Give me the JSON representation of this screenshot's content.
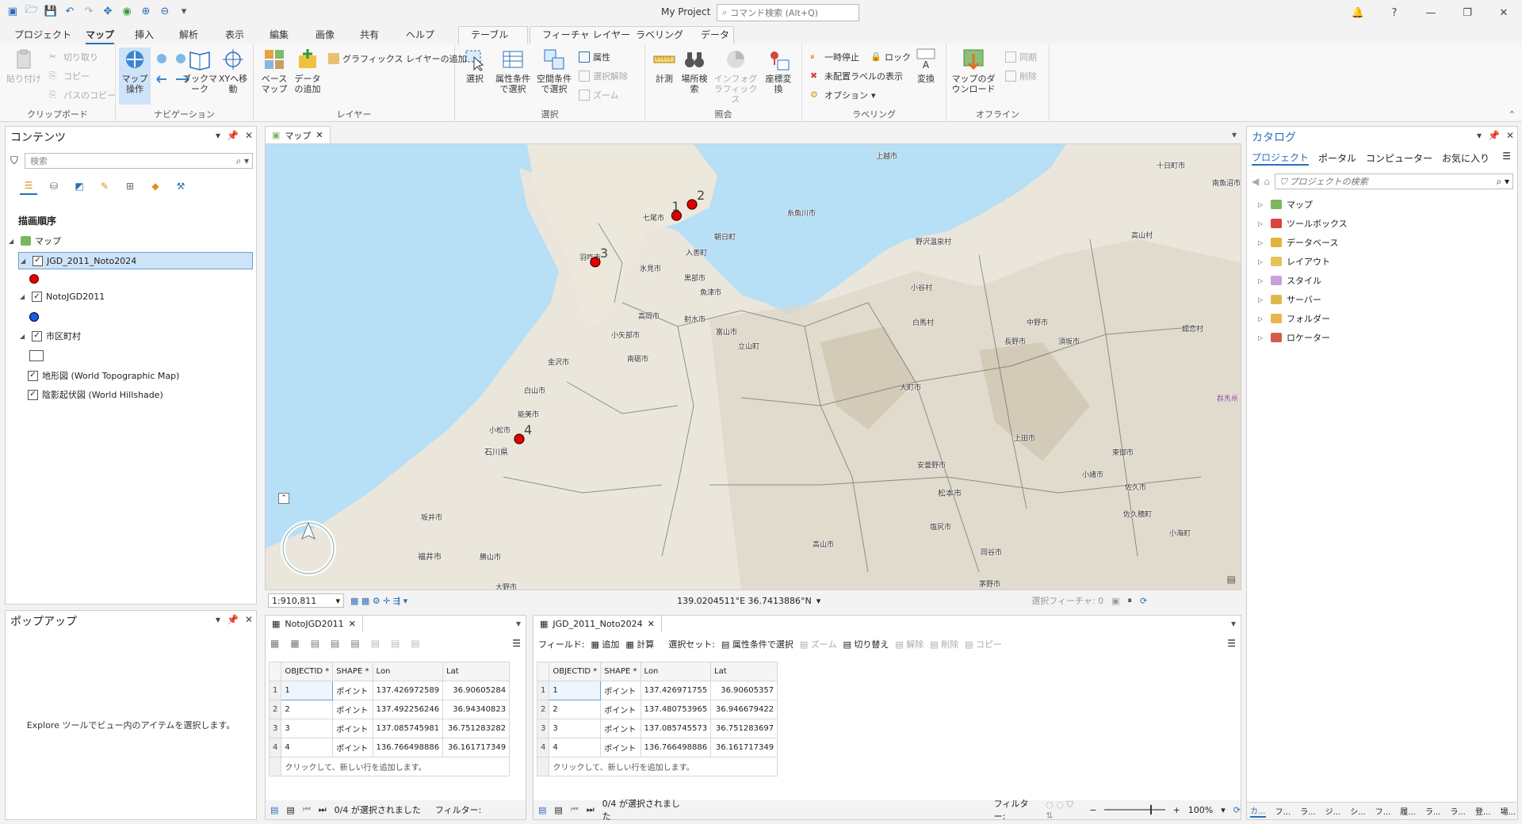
{
  "app": {
    "title": "My Project",
    "command_search_placeholder": "コマンド検索 (Alt+Q)"
  },
  "ribbon_tabs": [
    "プロジェクト",
    "マップ",
    "挿入",
    "解析",
    "表示",
    "編集",
    "画像",
    "共有",
    "ヘルプ",
    "テーブル",
    "フィーチャ レイヤー",
    "ラベリング",
    "データ"
  ],
  "ribbon": {
    "clipboard": {
      "paste": "貼り付け",
      "cut": "切り取り",
      "copy": "コピー",
      "copy_path": "パスのコピー",
      "label": "クリップボード"
    },
    "navigation": {
      "explore": "マップ操作",
      "bookmarks": "ブックマーク",
      "goto_xy": "XYへ移動",
      "label": "ナビゲーション"
    },
    "layer": {
      "basemap": "ベースマップ",
      "add_data": "データの追加",
      "add_graphics": "グラフィックス レイヤーの追加",
      "label": "レイヤー"
    },
    "selection": {
      "select": "選択",
      "by_attr": "属性条件で選択",
      "by_location": "空間条件で選択",
      "attributes": "属性",
      "clear": "選択解除",
      "zoom": "ズーム",
      "label": "選択"
    },
    "inquiry": {
      "measure": "計測",
      "locate": "場所検索",
      "infographics": "インフォグラフィックス",
      "convert_coords": "座標変換",
      "label": "照会"
    },
    "labeling": {
      "pause": "一時停止",
      "lock": "ロック",
      "unplaced": "未配置ラベルの表示",
      "options": "オプション",
      "convert": "変換",
      "label": "ラベリング"
    },
    "offline": {
      "download": "マップのダウンロード",
      "sync": "同期",
      "remove": "削除",
      "label": "オフライン"
    }
  },
  "contents": {
    "title": "コンテンツ",
    "search_placeholder": "検索",
    "drawing_order": "描画順序",
    "map_name": "マップ",
    "layers": [
      {
        "name": "JGD_2011_Noto2024",
        "symbol_color": "#e00000",
        "checked": true,
        "selected": true
      },
      {
        "name": "NotoJGD2011",
        "symbol_color": "#1a5fe0",
        "checked": true,
        "selected": false
      },
      {
        "name": "市区町村",
        "symbol_color": "#ffffff",
        "checked": true,
        "selected": false
      },
      {
        "name": "地形図 (World Topographic Map)",
        "checked": true
      },
      {
        "name": "陰影起伏図 (World Hillshade)",
        "checked": true
      }
    ]
  },
  "popup": {
    "title": "ポップアップ",
    "message": "Explore ツールでビュー内のアイテムを選択します。"
  },
  "map": {
    "tab": "マップ",
    "scale": "1:910,811",
    "coords": "139.0204511°E 36.7413886°N",
    "selected_features": "選択フィーチャ: 0",
    "points": [
      {
        "label": "1",
        "lon": 137.426972589,
        "lat": 36.90605284
      },
      {
        "label": "2",
        "lon": 137.492256246,
        "lat": 36.94340823
      },
      {
        "label": "3",
        "lon": 137.085745981,
        "lat": 36.751283282
      },
      {
        "label": "4",
        "lon": 136.766498886,
        "lat": 36.161717349
      }
    ],
    "place_labels": [
      "上越市",
      "十日町市",
      "南魚沼市",
      "糸魚川市",
      "朝日町",
      "入善町",
      "野沢温泉村",
      "黒部市",
      "魚津市",
      "羽咋市",
      "七尾市",
      "氷見市",
      "高岡市",
      "射水市",
      "富山市",
      "立山町",
      "小谷村",
      "白馬村",
      "中野市",
      "須坂市",
      "長野市",
      "小矢部市",
      "南砺市",
      "大町市",
      "金沢市",
      "白山市",
      "能美市",
      "小松市",
      "石川県",
      "上田市",
      "東御市",
      "小諸市",
      "佐久市",
      "佐久穂町",
      "安曇野市",
      "松本市",
      "塩尻市",
      "高山市",
      "坂井市",
      "福井市",
      "勝山市",
      "大野市",
      "岡谷市",
      "茅野市",
      "小海町",
      "嬬恋村",
      "群馬県",
      "高山村"
    ]
  },
  "tables": [
    {
      "tab": "NotoJGD2011",
      "columns": [
        "OBJECTID *",
        "SHAPE *",
        "Lon",
        "Lat"
      ],
      "rows": [
        [
          "1",
          "ポイント",
          "137.426972589",
          "36.90605284"
        ],
        [
          "2",
          "ポイント",
          "137.492256246",
          "36.94340823"
        ],
        [
          "3",
          "ポイント",
          "137.085745981",
          "36.751283282"
        ],
        [
          "4",
          "ポイント",
          "136.766498886",
          "36.161717349"
        ]
      ],
      "add_row": "クリックして、新しい行を追加します。",
      "status": "0/4 が選択されました",
      "filter": "フィルター:"
    },
    {
      "tab": "JGD_2011_Noto2024",
      "columns": [
        "OBJECTID *",
        "SHAPE *",
        "Lon",
        "Lat"
      ],
      "rows": [
        [
          "1",
          "ポイント",
          "137.426971755",
          "36.90605357"
        ],
        [
          "2",
          "ポイント",
          "137.480753965",
          "36.946679422"
        ],
        [
          "3",
          "ポイント",
          "137.085745573",
          "36.751283697"
        ],
        [
          "4",
          "ポイント",
          "136.766498886",
          "36.161717349"
        ]
      ],
      "add_row": "クリックして、新しい行を追加します。",
      "status": "0/4 が選択されました",
      "filter": "フィルター:",
      "toolbar": {
        "field": "フィールド:",
        "add": "追加",
        "calc": "計算",
        "selection_set": "選択セット:",
        "by_attr": "属性条件で選択",
        "zoom": "ズーム",
        "switch": "切り替え",
        "clear": "解除",
        "delete": "削除",
        "copy": "コピー"
      }
    }
  ],
  "zoom": "100%",
  "catalog": {
    "title": "カタログ",
    "tabs": [
      "プロジェクト",
      "ポータル",
      "コンピューター",
      "お気に入り"
    ],
    "search_placeholder": "プロジェクトの検索",
    "items": [
      {
        "name": "マップ",
        "color": "#7bb661"
      },
      {
        "name": "ツールボックス",
        "color": "#d9443c"
      },
      {
        "name": "データベース",
        "color": "#e3b23c"
      },
      {
        "name": "レイアウト",
        "color": "#e6c25a"
      },
      {
        "name": "スタイル",
        "color": "#c8a2d8"
      },
      {
        "name": "サーバー",
        "color": "#e0b84a"
      },
      {
        "name": "フォルダー",
        "color": "#e6b84a"
      },
      {
        "name": "ロケーター",
        "color": "#d65a4a"
      }
    ],
    "bottom_tabs": [
      "カ...",
      "フ...",
      "ラ...",
      "ジ...",
      "シ...",
      "フ...",
      "履...",
      "ラ...",
      "ラ...",
      "登...",
      "場..."
    ]
  }
}
